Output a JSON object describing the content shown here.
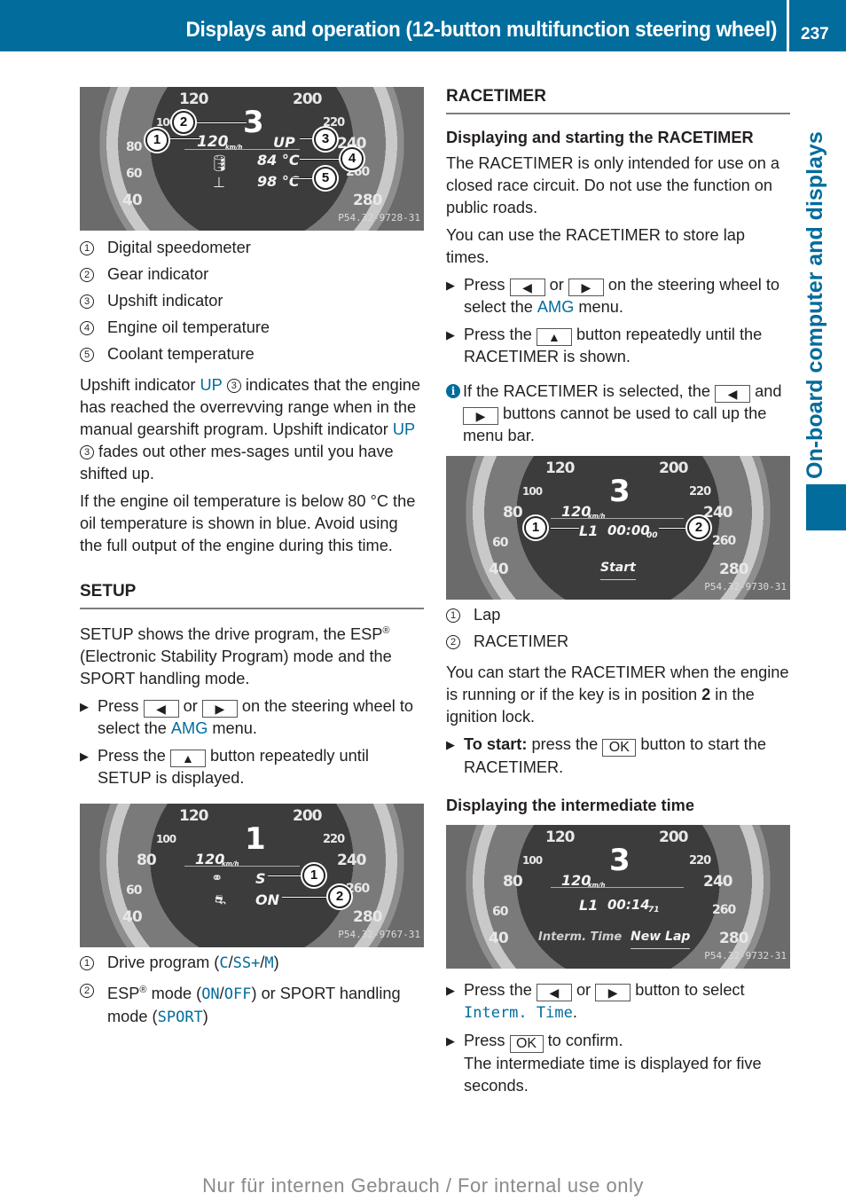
{
  "header": {
    "title": "Displays and operation (12-button multifunction steering wheel)",
    "page_number": "237",
    "color": "#026c9c"
  },
  "side_tab": {
    "label": "On-board computer and displays"
  },
  "left": {
    "figure1": {
      "ticks": [
        "120",
        "200",
        "100",
        "220",
        "240",
        "80",
        "60",
        "260",
        "40",
        "280"
      ],
      "speed": "120",
      "speed_unit": "km/h",
      "gear": "3",
      "upshift": "UP",
      "oil_temp": "84 °C",
      "coolant_temp": "98 °C",
      "ref": "P54.32-9728-31",
      "callouts": [
        "1",
        "2",
        "3",
        "4",
        "5"
      ]
    },
    "legend1": [
      {
        "num": "1",
        "text": "Digital speedometer"
      },
      {
        "num": "2",
        "text": "Gear indicator"
      },
      {
        "num": "3",
        "text": "Upshift indicator"
      },
      {
        "num": "4",
        "text": "Engine oil temperature"
      },
      {
        "num": "5",
        "text": "Coolant temperature"
      }
    ],
    "para1": {
      "a": "Upshift indicator ",
      "up": "UP",
      "num": "3",
      "b": " indicates that the engine has reached the overrevving range when in the manual gearshift program. Upshift indicator ",
      "c": " fades out other mes-sages until you have shifted up."
    },
    "para2": "If the engine oil temperature is below 80 °C the oil temperature is shown in blue. Avoid using the full output of the engine during this time.",
    "setup": {
      "title": "SETUP",
      "intro_a": "SETUP shows the drive program, the ESP",
      "intro_reg": "®",
      "intro_b": " (Electronic Stability Program) mode and the SPORT handling mode.",
      "step1": {
        "a": "Press ",
        "key_left": "◀",
        "or": " or ",
        "key_right": "▶",
        "b": " on the steering wheel to select the ",
        "menu": "AMG",
        "c": " menu."
      },
      "step2": {
        "a": "Press the ",
        "key_up": "▲",
        "b": " button repeatedly until SETUP is displayed."
      }
    },
    "figure2": {
      "ticks": [
        "120",
        "200",
        "100",
        "220",
        "80",
        "240",
        "60",
        "260",
        "40",
        "280"
      ],
      "speed": "120",
      "speed_unit": "km/h",
      "gear": "1",
      "drive_program": "S",
      "esp": "ON",
      "ref": "P54.32-9767-31",
      "callouts": [
        "1",
        "2"
      ]
    },
    "legend2": [
      {
        "num": "1",
        "a": "Drive program (",
        "codes": [
          "C",
          "/",
          "SS+",
          "/",
          "M"
        ],
        "b": ")"
      },
      {
        "num": "2",
        "a": "ESP",
        "reg": "®",
        "b": " mode (",
        "codes": [
          "ON",
          "/",
          "OFF"
        ],
        "c": ") or SPORT handling mode (",
        "code2": "SPORT",
        "d": ")"
      }
    ]
  },
  "right": {
    "racetimer": {
      "title": "RACETIMER",
      "subtitle": "Displaying and starting the RACETIMER",
      "p1": "The RACETIMER is only intended for use on a closed race circuit. Do not use the function on public roads.",
      "p2": "You can use the RACETIMER to store lap times.",
      "step1": {
        "a": "Press ",
        "key_left": "◀",
        "or": " or ",
        "key_right": "▶",
        "b": " on the steering wheel to select the ",
        "menu": "AMG",
        "c": " menu."
      },
      "step2": {
        "a": "Press the ",
        "key_up": "▲",
        "b": " button repeatedly until the RACETIMER is shown."
      },
      "note": {
        "a": "If the RACETIMER is selected, the ",
        "key_left": "◀",
        "b": " and ",
        "key_right": "▶",
        "c": " buttons cannot be used to call up the menu bar."
      }
    },
    "figure3": {
      "ticks": [
        "120",
        "200",
        "100",
        "220",
        "80",
        "240",
        "60",
        "260",
        "40",
        "280"
      ],
      "speed": "120",
      "speed_unit": "km/h",
      "gear": "3",
      "lap": "L1",
      "time": "00:00",
      "time_frac": "00",
      "button": "Start",
      "ref": "P54.32-9730-31",
      "callouts": [
        "1",
        "2"
      ]
    },
    "legend3": [
      {
        "num": "1",
        "text": "Lap"
      },
      {
        "num": "2",
        "text": "RACETIMER"
      }
    ],
    "p3": {
      "a": "You can start the RACETIMER when the engine is running or if the key is in position ",
      "bold": "2",
      "b": " in the ignition lock."
    },
    "step3": {
      "bold": "To start:",
      "a": " press the ",
      "key": "OK",
      "b": " button to start the RACETIMER."
    },
    "subtitle2": "Displaying the intermediate time",
    "figure4": {
      "ticks": [
        "120",
        "200",
        "100",
        "220",
        "80",
        "240",
        "60",
        "260",
        "40",
        "280"
      ],
      "speed": "120",
      "speed_unit": "km/h",
      "gear": "3",
      "lap": "L1",
      "time": "00:14",
      "time_frac": "71",
      "btn1": "Interm. Time",
      "btn2": "New Lap",
      "ref": "P54.32-9732-31"
    },
    "step4": {
      "a": "Press the ",
      "key_left": "◀",
      "or": " or ",
      "key_right": "▶",
      "b": " button to select ",
      "menu": "Interm. Time",
      "c": "."
    },
    "step5": {
      "a": "Press ",
      "key": "OK",
      "b": " to confirm.",
      "result": "The intermediate time is displayed for five seconds."
    }
  },
  "footer": "Nur für internen Gebrauch / For internal use only"
}
